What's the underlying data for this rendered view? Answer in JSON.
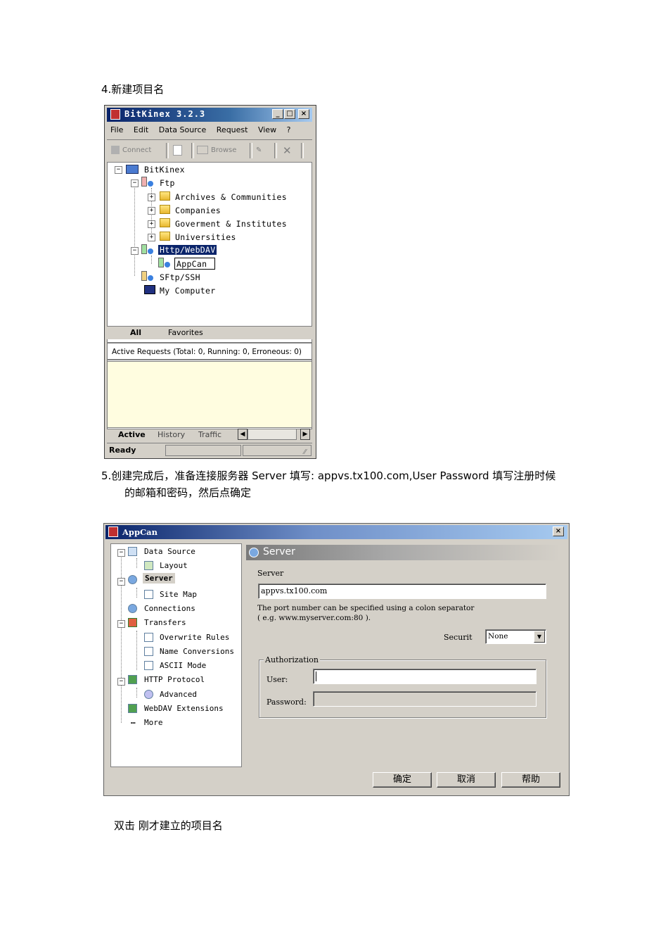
{
  "doc": {
    "step4": "4.新建项目名",
    "step5_line1": "5.创建完成后，准备连接服务器 Server  填写: appvs.tx100.com,User Password  填写注册时候",
    "step5_line2": "的邮箱和密码，然后点确定",
    "step6": "双击  刚才建立的项目名"
  },
  "bitkinex": {
    "title": "BitKinex 3.2.3",
    "menu": [
      "File",
      "Edit",
      "Data Source",
      "Request",
      "View",
      "?"
    ],
    "toolbar": {
      "connect": "Connect",
      "browse": "Browse"
    },
    "tree": {
      "root": "BitKinex",
      "ftp": "Ftp",
      "ftp_children": [
        "Archives & Communities",
        "Companies",
        "Goverment & Institutes",
        "Universities"
      ],
      "http": "Http/WebDAV",
      "appcan": "AppCan",
      "sftp": "SFtp/SSH",
      "mycomputer": "My Computer"
    },
    "tabs_top": {
      "all": "All",
      "favorites": "Favorites"
    },
    "active_requests": "Active Requests (Total: 0, Running: 0, Erroneous: 0)",
    "tabs_bottom": {
      "active": "Active",
      "history": "History",
      "traffic": "Traffic"
    },
    "status": "Ready"
  },
  "appcan": {
    "title": "AppCan",
    "tree": {
      "data_source": "Data Source",
      "layout": "Layout",
      "server": "Server",
      "site_map": "Site Map",
      "connections": "Connections",
      "transfers": "Transfers",
      "overwrite_rules": "Overwrite Rules",
      "name_conversions": "Name Conversions",
      "ascii_mode": "ASCII Mode",
      "http_protocol": "HTTP Protocol",
      "advanced": "Advanced",
      "webdav_ext": "WebDAV Extensions",
      "more": "More"
    },
    "panel_header": "Server",
    "server_label": "Server",
    "server_value": "appvs.tx100.com",
    "port_hint_1": "The port number can be specified using a colon separator",
    "port_hint_2": "( e.g. www.myserver.com:80 ).",
    "security_label": "Securit",
    "security_value": "None",
    "auth_group": "Authorization",
    "user_label": "User:",
    "user_value": "",
    "password_label": "Password:",
    "password_value": "",
    "ok": "确定",
    "cancel": "取消",
    "help": "帮助"
  },
  "colors": {
    "title_dark": "#0a246a",
    "selection": "#0a246a",
    "panel_bg": "#d4d0c8",
    "pane_yellow": "#fffde0"
  }
}
